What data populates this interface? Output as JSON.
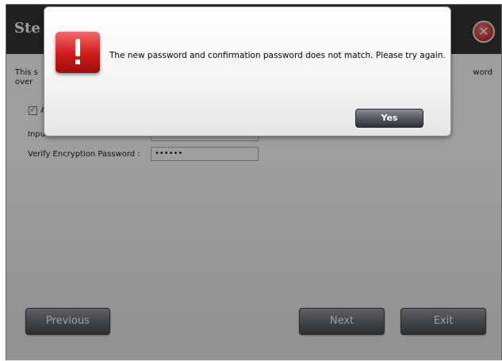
{
  "wizard": {
    "title": "Ste",
    "close_icon": "close-icon",
    "description_left_line1": "This s",
    "description_left_line2": "over",
    "description_right": "word",
    "checkbox_label": "A",
    "input_password_label": "Inpu",
    "verify_password_label": "Verify Encryption Password :",
    "verify_password_value": "••••••",
    "buttons": {
      "previous": "Previous",
      "next": "Next",
      "exit": "Exit"
    }
  },
  "dialog": {
    "icon": "alert-icon",
    "message": "The new password and confirmation password does not match. Please try again.",
    "yes_label": "Yes"
  },
  "colors": {
    "accent_red": "#d11a1a",
    "header_black": "#1c1c1c"
  }
}
